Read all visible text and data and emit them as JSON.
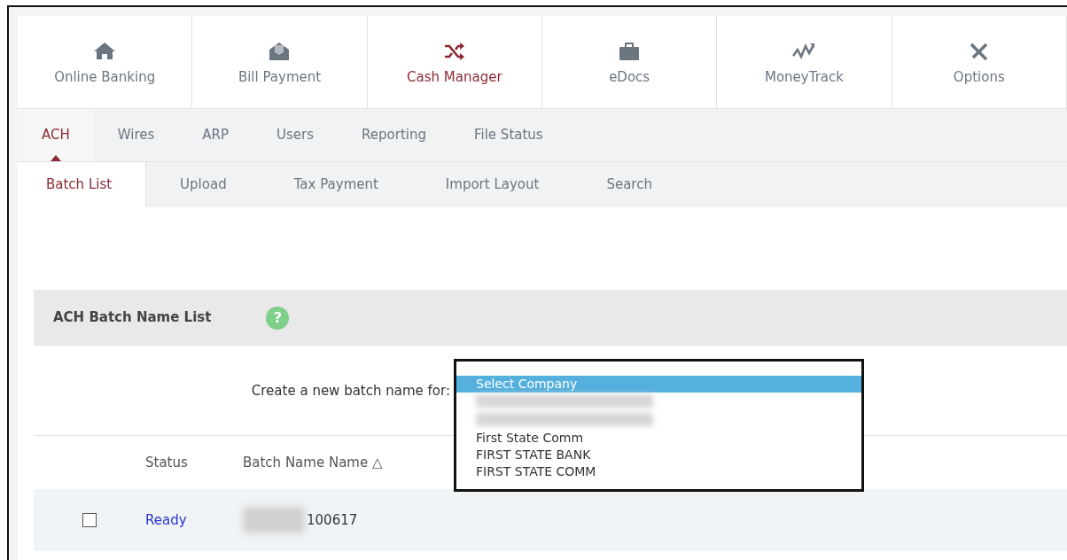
{
  "main_nav": [
    {
      "label": "Online Banking",
      "selected": false
    },
    {
      "label": "Bill Payment",
      "selected": false
    },
    {
      "label": "Cash Manager",
      "selected": true
    },
    {
      "label": "eDocs",
      "selected": false
    },
    {
      "label": "MoneyTrack",
      "selected": false
    },
    {
      "label": "Options",
      "selected": false
    }
  ],
  "sub_nav": [
    {
      "label": "ACH",
      "selected": true
    },
    {
      "label": "Wires",
      "selected": false
    },
    {
      "label": "ARP",
      "selected": false
    },
    {
      "label": "Users",
      "selected": false
    },
    {
      "label": "Reporting",
      "selected": false
    },
    {
      "label": "File Status",
      "selected": false
    }
  ],
  "section_tabs": [
    {
      "label": "Batch List",
      "selected": true
    },
    {
      "label": "Upload",
      "selected": false
    },
    {
      "label": "Tax Payment",
      "selected": false
    },
    {
      "label": "Import Layout",
      "selected": false
    },
    {
      "label": "Search",
      "selected": false
    }
  ],
  "panel": {
    "title": "ACH Batch Name List",
    "help": "?",
    "create_label": "Create a new batch name for:",
    "company_list": [
      {
        "kind": "option",
        "label": "Select Company",
        "selected": true
      },
      {
        "kind": "redacted",
        "selected": false
      },
      {
        "kind": "redacted",
        "selected": false
      },
      {
        "kind": "option",
        "label": "First State Comm",
        "selected": false
      },
      {
        "kind": "option",
        "label": "FIRST STATE BANK",
        "selected": false
      },
      {
        "kind": "option",
        "label": "FIRST STATE COMM",
        "selected": false
      }
    ],
    "columns": [
      "Status",
      "Batch Name Name △"
    ],
    "rows": [
      {
        "checked": false,
        "status": "Ready",
        "batch_name": "100617",
        "redacted_prefix": true
      }
    ]
  }
}
